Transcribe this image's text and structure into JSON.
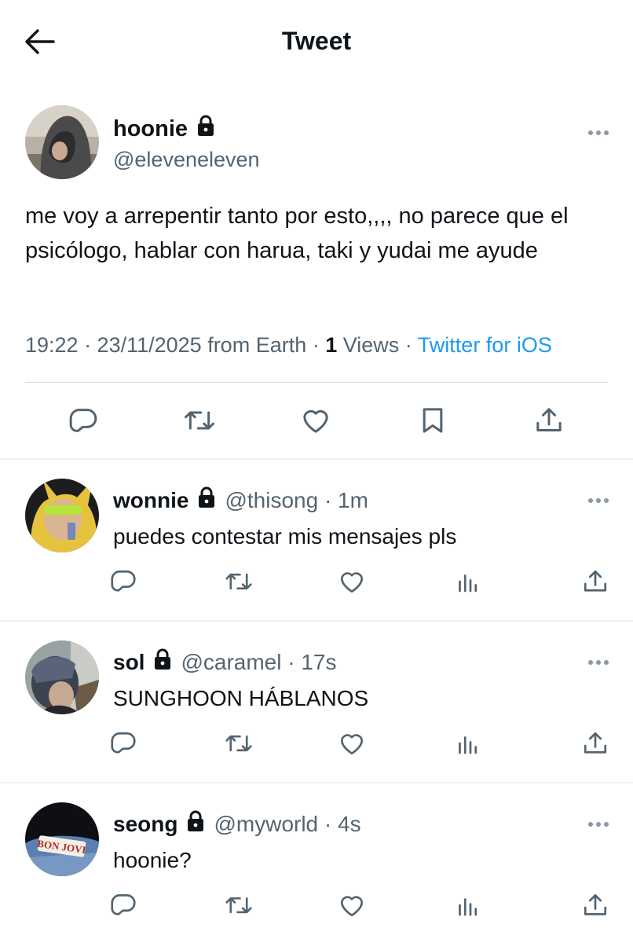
{
  "header": {
    "title": "Tweet"
  },
  "tweet": {
    "name": "hoonie",
    "handle": "@eleveneleven",
    "text": "me voy a arrepentir tanto por esto,,,, no parece que el psicólogo, hablar con harua, taki y yudai me ayude",
    "time": "19:22 · 23/11/2025 from Earth · ",
    "views_count": "1",
    "views_label": " Views · ",
    "source": "Twitter for iOS"
  },
  "replies": [
    {
      "name": "wonnie",
      "handle": "@thisong · 1m",
      "text": "puedes contestar mis mensajes pls"
    },
    {
      "name": "sol",
      "handle": "@caramel · 17s",
      "text": "SUNGHOON HÁBLANOS"
    },
    {
      "name": "seong",
      "handle": "@myworld · 4s",
      "text": "hoonie?"
    }
  ],
  "avatar_badge": "BON JOVI",
  "colors": {
    "text": "#0f1419",
    "secondary": "#536471",
    "link": "#1d9bf0",
    "icon": "#536471",
    "divider": "#eff3f4"
  },
  "icons": [
    "back-arrow-icon",
    "lock-icon",
    "more-icon",
    "reply-icon",
    "retweet-icon",
    "like-icon",
    "bookmark-icon",
    "share-icon",
    "analytics-icon"
  ]
}
